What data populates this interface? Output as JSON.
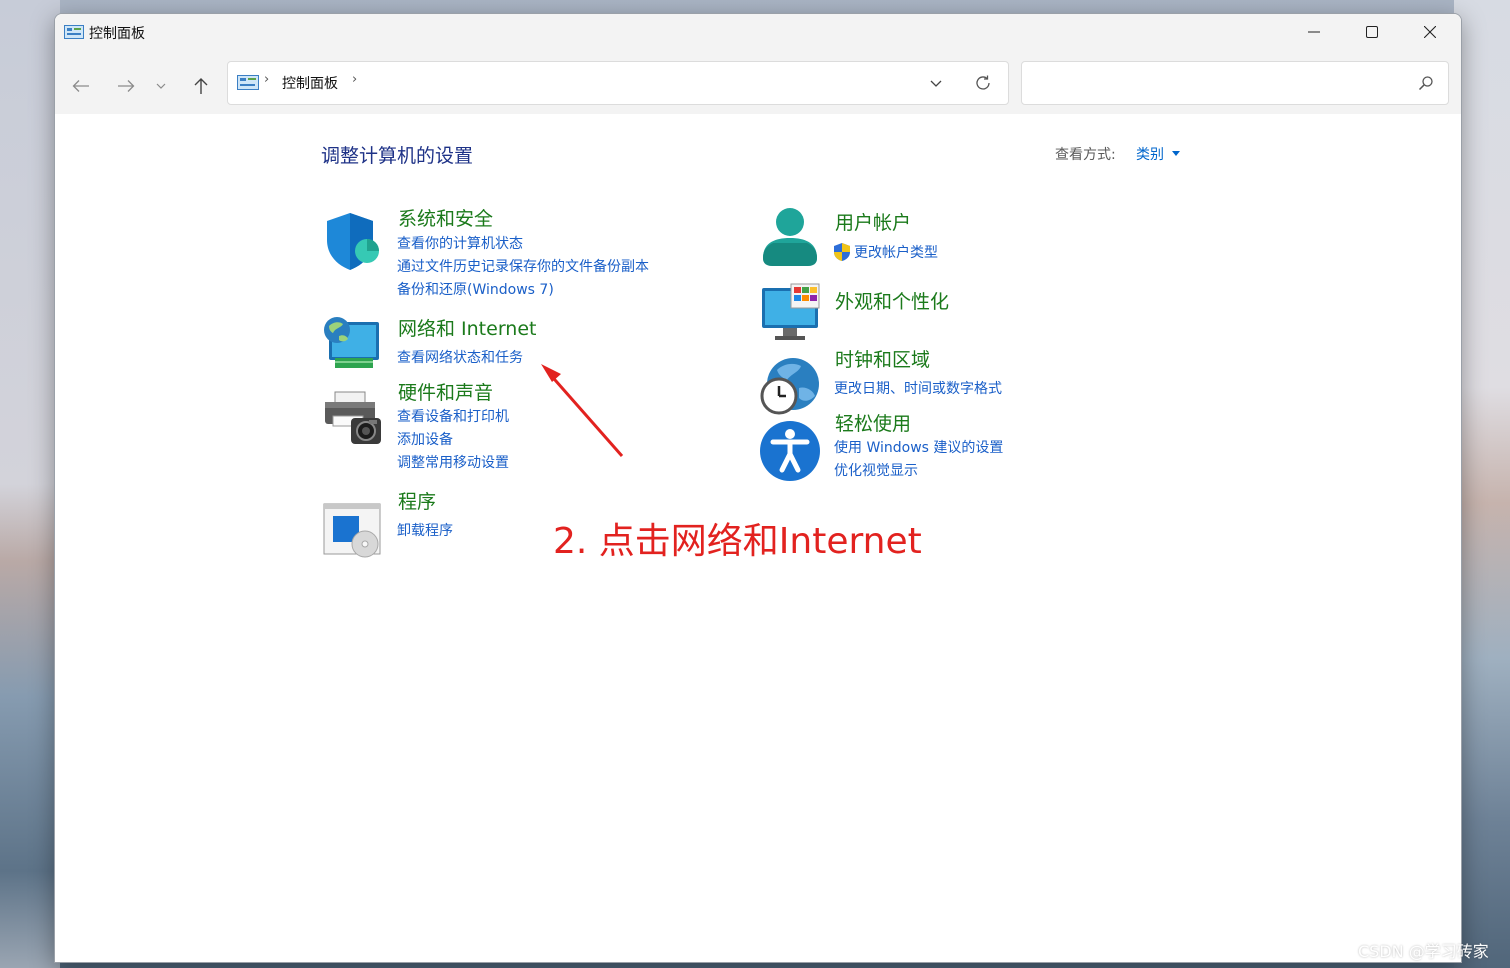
{
  "window": {
    "title": "控制面板"
  },
  "address": {
    "path": "控制面板",
    "separator": "›"
  },
  "search": {
    "placeholder": ""
  },
  "page": {
    "title": "调整计算机的设置",
    "view_label": "查看方式:",
    "view_value": "类别"
  },
  "categories_left": [
    {
      "title": "系统和安全",
      "links": [
        "查看你的计算机状态",
        "通过文件历史记录保存你的文件备份副本",
        "备份和还原(Windows 7)"
      ]
    },
    {
      "title": "网络和 Internet",
      "links": [
        "查看网络状态和任务"
      ]
    },
    {
      "title": "硬件和声音",
      "links": [
        "查看设备和打印机",
        "添加设备",
        "调整常用移动设置"
      ]
    },
    {
      "title": "程序",
      "links": [
        "卸载程序"
      ]
    }
  ],
  "categories_right": [
    {
      "title": "用户帐户",
      "links": [
        "更改帐户类型"
      ]
    },
    {
      "title": "外观和个性化",
      "links": []
    },
    {
      "title": "时钟和区域",
      "links": [
        "更改日期、时间或数字格式"
      ]
    },
    {
      "title": "轻松使用",
      "links": [
        "使用 Windows 建议的设置",
        "优化视觉显示"
      ]
    }
  ],
  "annotation": {
    "text": "2. 点击网络和Internet",
    "color": "#e2221f"
  },
  "watermark": "CSDN @学习砖家",
  "colors": {
    "category_title": "#1b7a1b",
    "link": "#1a5fc8",
    "page_title": "#1e3287"
  }
}
